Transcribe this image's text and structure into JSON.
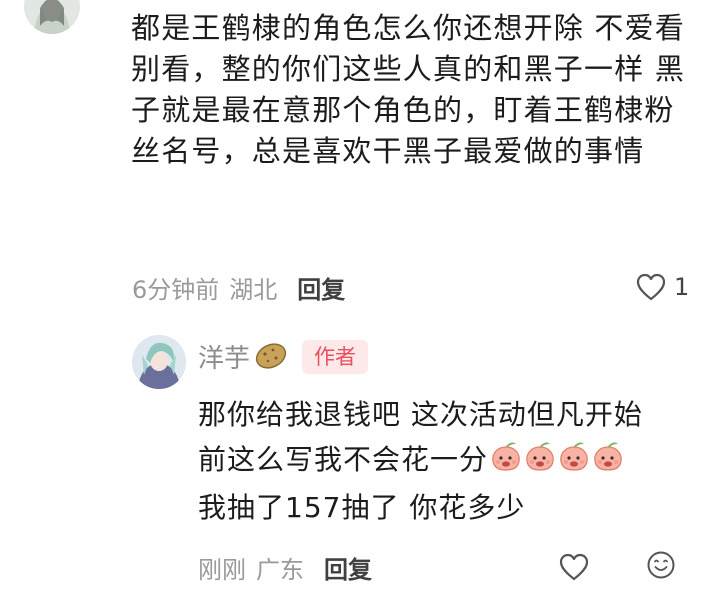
{
  "comment": {
    "text": "都是王鹤棣的角色怎么你还想开除 不爱看别看，整的你们这些人真的和黑子一样 黑子就是最在意那个角色的，盯着王鹤棣粉丝名号，总是喜欢干黑子最爱做的事情",
    "time": "6分钟前",
    "location": "湖北",
    "reply_label": "回复",
    "like_count": "1"
  },
  "reply": {
    "username": "洋芋",
    "badge": "作者",
    "line1": "那你给我退钱吧 这次活动但凡开始",
    "line2": "前这么写我不会花一分",
    "line3": "我抽了157抽了 你花多少",
    "emoji_count": 4,
    "time": "刚刚",
    "location": "广东",
    "reply_label": "回复"
  },
  "icons": {
    "like": "heart-outline-icon",
    "emoji": "smiley-face-icon",
    "sticker": "peach-emoji",
    "name_emoji": "potato-emoji"
  },
  "colors": {
    "badge_bg": "#fde9ea",
    "badge_text": "#e8505b",
    "meta_text": "#9a9a9a"
  }
}
